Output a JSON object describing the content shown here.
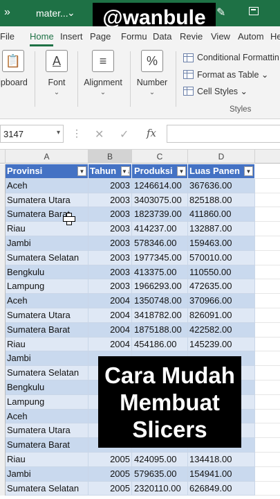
{
  "titlebar": {
    "quick_access": "»",
    "filename": "mater...",
    "filename_dropdown": "⌄",
    "accent_color": "#1e7145"
  },
  "watermark": "@wanbule",
  "ribbon_tabs": [
    "File",
    "Home",
    "Insert",
    "Page",
    "Formu",
    "Data",
    "Revie",
    "View",
    "Autom",
    "He"
  ],
  "ribbon": {
    "clipboard_label": "ipboard",
    "font_label": "Font",
    "alignment_label": "Alignment",
    "number_label": "Number",
    "number_icon": "%",
    "font_icon": "A",
    "conditional_formatting": "Conditional Formattin",
    "format_as_table": "Format as Table ⌄",
    "cell_styles": "Cell Styles ⌄",
    "styles_group": "Styles"
  },
  "formula_bar": {
    "name_box": "3147",
    "fx": "fx",
    "value": ""
  },
  "columns": [
    "A",
    "B",
    "C",
    "D"
  ],
  "table": {
    "headers": [
      "Provinsi",
      "Tahun",
      "Produksi",
      "Luas Panen"
    ],
    "rows": [
      [
        "Aceh",
        "2003",
        "1246614.00",
        "367636.00"
      ],
      [
        "Sumatera Utara",
        "2003",
        "3403075.00",
        "825188.00"
      ],
      [
        "Sumatera Barat",
        "2003",
        "1823739.00",
        "411860.00"
      ],
      [
        "Riau",
        "2003",
        "414237.00",
        "132887.00"
      ],
      [
        "Jambi",
        "2003",
        "578346.00",
        "159463.00"
      ],
      [
        "Sumatera Selatan",
        "2003",
        "1977345.00",
        "570010.00"
      ],
      [
        "Bengkulu",
        "2003",
        "413375.00",
        "110550.00"
      ],
      [
        "Lampung",
        "2003",
        "1966293.00",
        "472635.00"
      ],
      [
        "Aceh",
        "2004",
        "1350748.00",
        "370966.00"
      ],
      [
        "Sumatera Utara",
        "2004",
        "3418782.00",
        "826091.00"
      ],
      [
        "Sumatera Barat",
        "2004",
        "1875188.00",
        "422582.00"
      ],
      [
        "Riau",
        "2004",
        "454186.00",
        "145239.00"
      ],
      [
        "Jambi",
        "",
        "",
        ""
      ],
      [
        "Sumatera Selatan",
        "",
        "",
        ""
      ],
      [
        "Bengkulu",
        "",
        "",
        ""
      ],
      [
        "Lampung",
        "",
        "",
        ""
      ],
      [
        "Aceh",
        "",
        "",
        ""
      ],
      [
        "Sumatera Utara",
        "",
        "",
        ""
      ],
      [
        "Sumatera Barat",
        "",
        "",
        ""
      ],
      [
        "Riau",
        "2005",
        "424095.00",
        "134418.00"
      ],
      [
        "Jambi",
        "2005",
        "579635.00",
        "154941.00"
      ],
      [
        "Sumatera Selatan",
        "2005",
        "2320110.00",
        "626849.00"
      ]
    ]
  },
  "caption": [
    "Cara Mudah",
    "Membuat",
    "Slicers"
  ],
  "colors": {
    "table_header": "#4472c4",
    "band_dark": "#c9d9ee",
    "band_light": "#dfe8f5"
  }
}
